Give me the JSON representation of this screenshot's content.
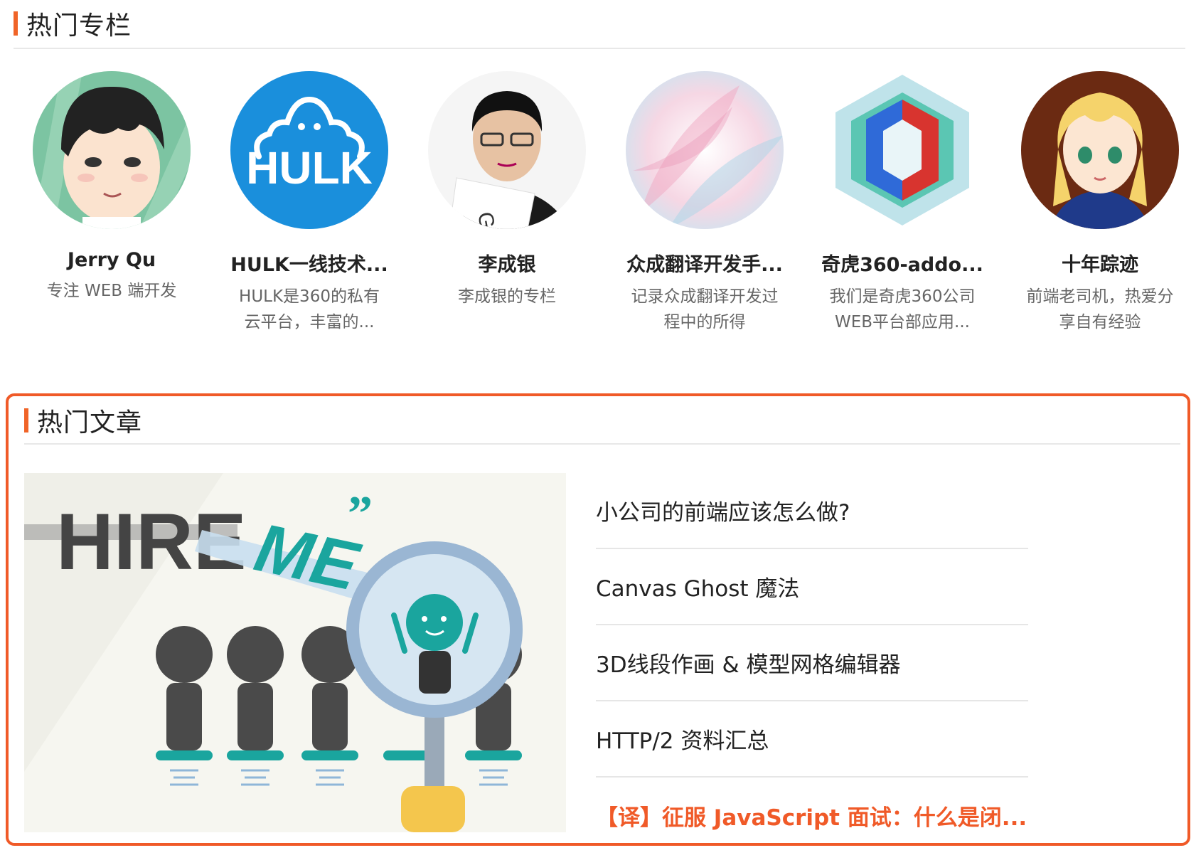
{
  "columns_section": {
    "title": "热门专栏",
    "items": [
      {
        "name": "Jerry Qu",
        "desc": "专注 WEB 端开发",
        "avatar": "cartoon-boy-avatar"
      },
      {
        "name": "HULK一线技术...",
        "desc": "HULK是360的私有云平台，丰富的...",
        "avatar": "hulk-logo-avatar"
      },
      {
        "name": "李成银",
        "desc": "李成银的专栏",
        "avatar": "photo-man-avatar"
      },
      {
        "name": "众成翻译开发手...",
        "desc": "记录众成翻译开发过程中的所得",
        "avatar": "pastel-petals-avatar"
      },
      {
        "name": "奇虎360-addo...",
        "desc": "我们是奇虎360公司WEB平台部应用...",
        "avatar": "hexagon-logo-avatar"
      },
      {
        "name": "十年踪迹",
        "desc": "前端老司机，热爱分享自有经验",
        "avatar": "anime-knight-avatar"
      }
    ]
  },
  "articles_section": {
    "title": "热门文章",
    "featured_image": {
      "text_hire": "HIRE",
      "text_me": "ME"
    },
    "items": [
      "小公司的前端应该怎么做?",
      "Canvas Ghost 魔法",
      "3D线段作画 & 模型网格编辑器",
      "HTTP/2 资料汇总",
      "【译】征服 JavaScript 面试：什么是闭..."
    ]
  },
  "colors": {
    "accent": "#f05a28",
    "hulk_blue": "#1a8fdc",
    "teal": "#1aa59e"
  }
}
